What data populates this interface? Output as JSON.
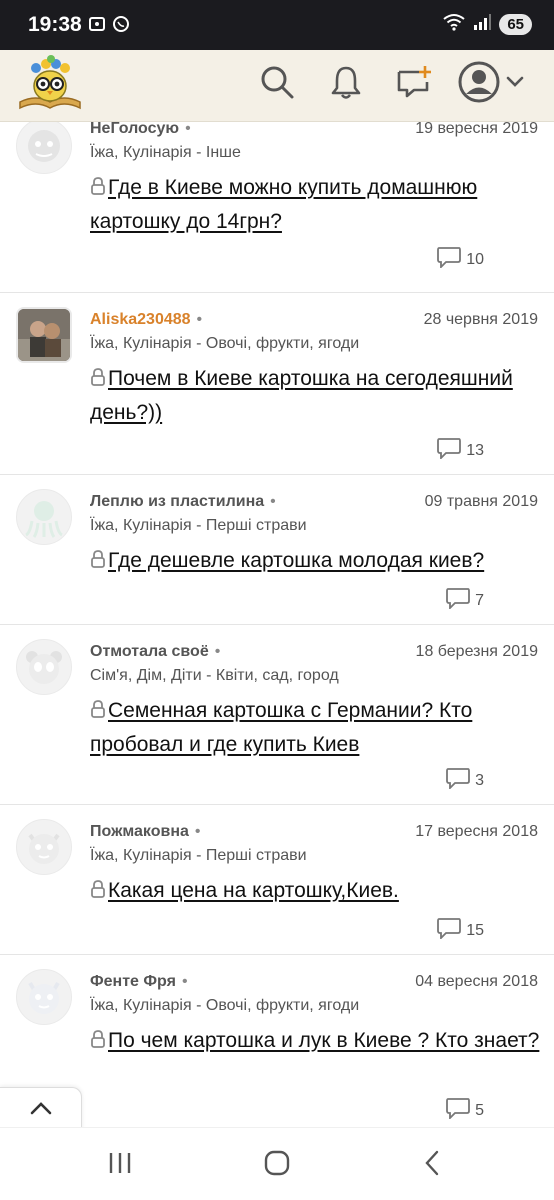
{
  "status_bar": {
    "time": "19:38",
    "battery": "65"
  },
  "header": {
    "logo_icon": "owl-books-logo",
    "search_icon": "search-icon",
    "notifications_icon": "bell-icon",
    "new_post_icon": "add-chat-icon",
    "profile_icon": "user-avatar-icon"
  },
  "posts": [
    {
      "username": "НеГолосую",
      "date": "19 вересня 2019",
      "category": "Їжа, Кулінарія - Інше",
      "title": "Где в Киеве можно купить домашнюю картошку до 14грн?",
      "comments": "10"
    },
    {
      "username": "Aliska230488",
      "date": "28 червня 2019",
      "category": "Їжа, Кулінарія - Овочі, фрукти, ягоди",
      "title": "Почем в Киеве картошка на сегодеяшний день?))",
      "comments": "13"
    },
    {
      "username": "Леплю из пластилина",
      "date": "09 травня 2019",
      "category": "Їжа, Кулінарія - Перші страви",
      "title": "Где дешевле картошка молодая киев?",
      "comments": "7"
    },
    {
      "username": "Отмотала своё",
      "date": "18 березня 2019",
      "category": "Сім'я, Дім, Діти - Квіти, сад, город",
      "title": "Семенная картошка с Германии? Кто пробовал и где купить Киев",
      "comments": "3"
    },
    {
      "username": "Пожмаковна",
      "date": "17 вересня 2018",
      "category": "Їжа, Кулінарія - Перші страви",
      "title": "Какая цена на картошку,Киев.",
      "comments": "15"
    },
    {
      "username": "Фенте Фря",
      "date": "04 вересня 2018",
      "category": "Їжа, Кулінарія - Овочі, фрукти, ягоди",
      "title": "По чем картошка и лук в Киеве ? Кто знает?",
      "comments": "5"
    }
  ],
  "colors": {
    "header_bg": "#f4f0e6",
    "highlight_username": "#d9822b",
    "status_bar_bg": "#1b1b1f"
  }
}
